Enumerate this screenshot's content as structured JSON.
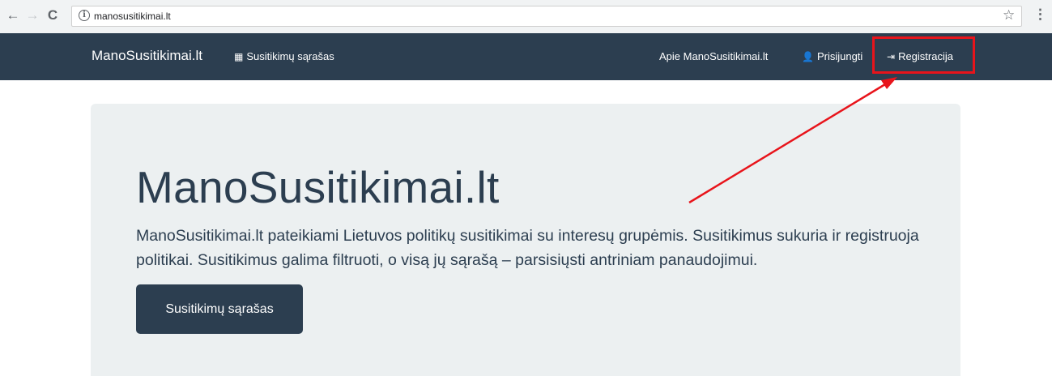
{
  "browser": {
    "url": "manosusitikimai.lt",
    "back_icon": "←",
    "forward_icon": "→",
    "reload_icon": "C",
    "info_icon": "i",
    "star_icon": "☆",
    "menu_icon": "⋮"
  },
  "navbar": {
    "brand": "ManoSusitikimai.lt",
    "meetings_link": "Susitikimų sąrašas",
    "about_link": "Apie ManoSusitikimai.lt",
    "login_link": "Prisijungti",
    "register_link": "Registracija",
    "calendar_icon": "▦",
    "user_icon": "👤",
    "signin_icon": "⇥"
  },
  "hero": {
    "title": "ManoSusitikimai.lt",
    "lead": "ManoSusitikimai.lt pateikiami Lietuvos politikų susitikimai su interesų grupėmis. Susitikimus sukuria ir registruoja politikai. Susitikimus galima filtruoti, o visą jų sąrašą – parsisiųsti antriniam panaudojimui.",
    "button_label": "Susitikimų sąrašas"
  },
  "colors": {
    "navbar_bg": "#2c3e50",
    "jumbotron_bg": "#ecf0f1",
    "highlight": "#e8141b"
  }
}
